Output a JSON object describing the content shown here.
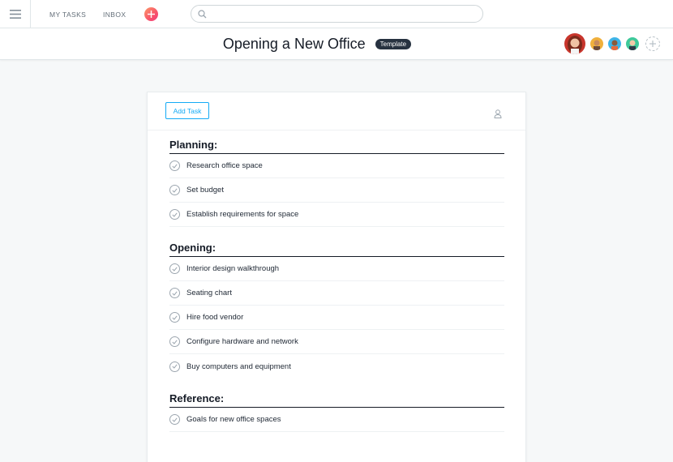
{
  "topbar": {
    "nav": {
      "my_tasks": "MY TASKS",
      "inbox": "INBOX"
    },
    "search": {
      "placeholder": "",
      "value": ""
    },
    "icons": {
      "menu": "hamburger-menu-icon",
      "plus": "plus-icon",
      "search": "search-icon"
    },
    "colors": {
      "accent": "#f8536a"
    }
  },
  "header": {
    "title": "Opening a New Office",
    "badge": "Template",
    "members": [
      "avatar-1",
      "avatar-2",
      "avatar-3",
      "avatar-4"
    ]
  },
  "card": {
    "add_task_label": "Add Task",
    "sections": [
      {
        "title": "Planning:",
        "tasks": [
          "Research office space",
          "Set budget",
          "Establish requirements for space"
        ]
      },
      {
        "title": "Opening:",
        "tasks": [
          "Interior design walkthrough",
          "Seating chart",
          "Hire food vendor",
          "Configure hardware and network",
          "Buy computers and equipment"
        ]
      },
      {
        "title": "Reference:",
        "tasks": [
          "Goals for new office spaces"
        ]
      }
    ]
  }
}
